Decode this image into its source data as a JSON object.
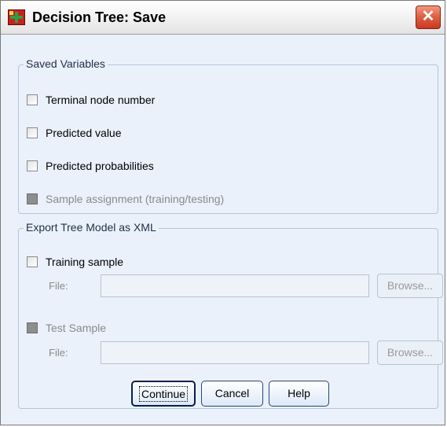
{
  "window": {
    "title": "Decision Tree: Save",
    "close_glyph": "✕"
  },
  "saved_variables": {
    "legend": "Saved Variables",
    "items": [
      {
        "label": "Terminal node number",
        "checked": false,
        "enabled": true
      },
      {
        "label": "Predicted value",
        "checked": false,
        "enabled": true
      },
      {
        "label": "Predicted probabilities",
        "checked": false,
        "enabled": true
      },
      {
        "label": "Sample assignment (training/testing)",
        "checked": false,
        "enabled": false
      }
    ]
  },
  "export_xml": {
    "legend": "Export Tree Model as XML",
    "training": {
      "label": "Training sample",
      "checked": false,
      "enabled": true,
      "file_label": "File:",
      "file_value": "",
      "browse_label": "Browse..."
    },
    "test": {
      "label": "Test Sample",
      "checked": false,
      "enabled": false,
      "file_label": "File:",
      "file_value": "",
      "browse_label": "Browse..."
    }
  },
  "buttons": {
    "continue": "Continue",
    "cancel": "Cancel",
    "help": "Help"
  },
  "icons": {
    "app": "decision-tree-app-icon",
    "close": "close-icon"
  }
}
